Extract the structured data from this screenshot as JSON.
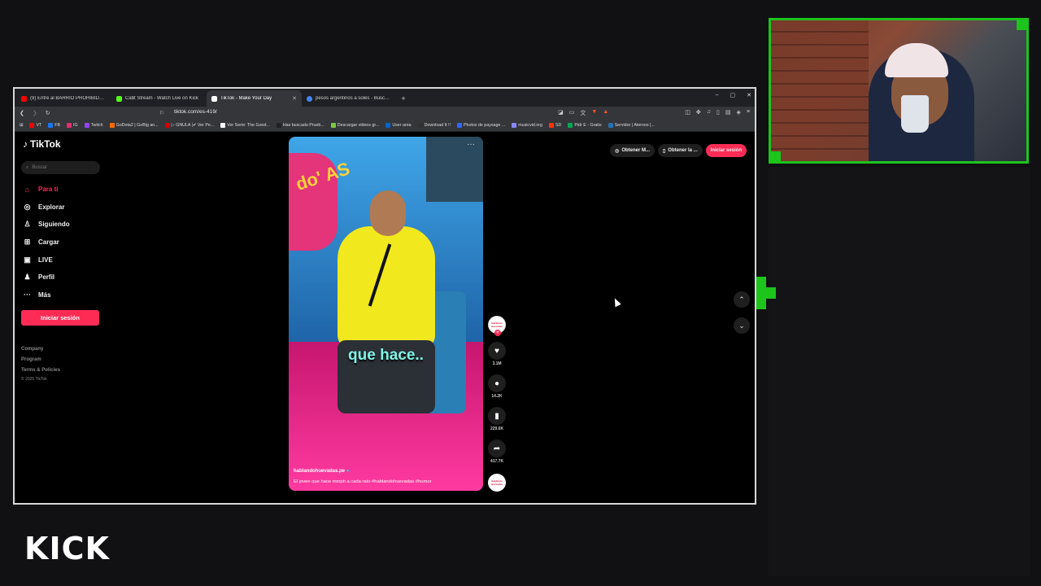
{
  "stream": {
    "platform_logo": "KICK"
  },
  "browser": {
    "tabs": [
      {
        "label": "(9) Entré al BARRIO PROHIBIDO de P",
        "favicon_color": "#ff0000",
        "active": false
      },
      {
        "label": "Ca$t Stream - Watch Live on Kick",
        "favicon_color": "#53fc18",
        "active": false
      },
      {
        "label": "TikTok - Make Your Day",
        "favicon_color": "#ffffff",
        "active": true
      },
      {
        "label": "pesos argentinos a soles - Buscar con",
        "favicon_color": "#4285f4",
        "active": false
      }
    ],
    "new_tab": "+",
    "window_controls": [
      "–",
      "▢",
      "✕"
    ],
    "url": "tiktok.com/es-419/",
    "bookmarks": [
      {
        "label": "VT",
        "color": "#ff0000"
      },
      {
        "label": "FB",
        "color": "#1877f2"
      },
      {
        "label": "IG",
        "color": "#e1306c"
      },
      {
        "label": "Twitch",
        "color": "#9146ff"
      },
      {
        "label": "GoDota2 | GoBig an...",
        "color": "#ff6b00"
      },
      {
        "label": "▷ GNULA |✔ Ver Pe...",
        "color": "#d40000"
      },
      {
        "label": "Ver Serie: The Good...",
        "color": "#ffffff"
      },
      {
        "label": "Has buscado Prueb...",
        "color": "#222222"
      },
      {
        "label": "Descargar videos gr...",
        "color": "#7ac943"
      },
      {
        "label": "User area",
        "color": "#0066cc"
      },
      {
        "label": "Download It !!",
        "color": "#333333"
      },
      {
        "label": "Photos de paysage ...",
        "color": "#3366ff"
      },
      {
        "label": "musicvid.org",
        "color": "#8888ff"
      },
      {
        "label": "SD",
        "color": "#ff3300"
      },
      {
        "label": "Pidr E - Gratis",
        "color": "#00aa55"
      },
      {
        "label": "Servidor | Aternos |...",
        "color": "#2a6fb3"
      }
    ]
  },
  "tiktok": {
    "logo": "TikTok",
    "search_placeholder": "Buscar",
    "nav": [
      {
        "label": "Para ti",
        "icon": "home-icon",
        "glyph": "⌂",
        "active": true
      },
      {
        "label": "Explorar",
        "icon": "compass-icon",
        "glyph": "◎",
        "active": false
      },
      {
        "label": "Siguiendo",
        "icon": "following-icon",
        "glyph": "♙",
        "active": false
      },
      {
        "label": "Cargar",
        "icon": "upload-icon",
        "glyph": "⊞",
        "active": false
      },
      {
        "label": "LIVE",
        "icon": "live-icon",
        "glyph": "▣",
        "active": false
      },
      {
        "label": "Perfil",
        "icon": "profile-icon",
        "glyph": "♟",
        "active": false
      },
      {
        "label": "Más",
        "icon": "more-icon",
        "glyph": "···",
        "active": false
      }
    ],
    "login_button": "Iniciar sesión",
    "footer": [
      "Company",
      "Program",
      "Terms & Policies"
    ],
    "copyright": "© 2025 TikTok",
    "top_actions": [
      "Obtener M...",
      "Obtener la ...",
      "Iniciar sesión"
    ],
    "video": {
      "caption_overlay": "que hace..",
      "username": "hablandohuevadas.pe",
      "description": "El joven que hace mmph a cada rato #hablandohuevadas #humor",
      "sign_text": "do' AS"
    },
    "actions": {
      "likes": "3.1M",
      "comments": "14.2K",
      "saves": "229.6K",
      "shares": "417.7K"
    },
    "avatar_text": "Hablando Huevadas",
    "accent_color": "#fe2c55"
  }
}
